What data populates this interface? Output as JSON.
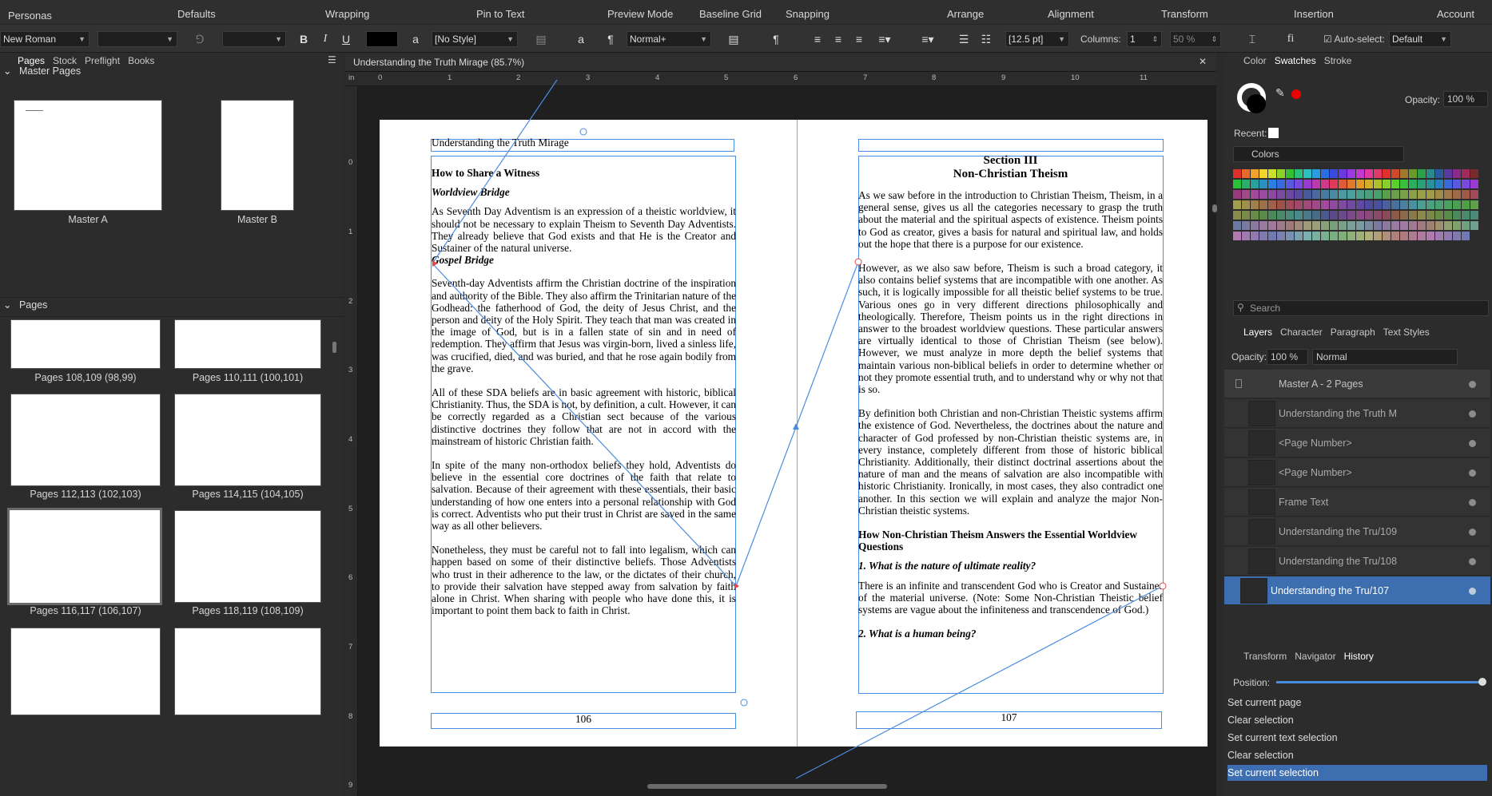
{
  "toolbar": {
    "personas": "Personas",
    "items": [
      "Defaults",
      "Wrapping",
      "Pin to Text",
      "Preview Mode",
      "Baseline Grid",
      "Snapping",
      "Arrange",
      "Alignment",
      "Transform",
      "Insertion",
      "Account"
    ]
  },
  "context": {
    "font": "New Roman",
    "style_none": "[No Style]",
    "para_style": "Normal+",
    "size": "[12.5 pt]",
    "columns_label": "Columns:",
    "columns": "1",
    "gutter": "50 %",
    "autoselect_label": "Auto-select:",
    "autoselect": "Default"
  },
  "left": {
    "tabs": [
      "Pages",
      "Stock",
      "Preflight",
      "Books"
    ],
    "master_title": "Master Pages",
    "masters": [
      "Master A",
      "Master B"
    ],
    "pages_title": "Pages",
    "page_captions": [
      "Pages 108,109 (98,99)",
      "Pages 110,111 (100,101)",
      "Pages 112,113 (102,103)",
      "Pages 114,115 (104,105)",
      "Pages 116,117 (106,107)",
      "Pages 118,119 (108,109)"
    ]
  },
  "doc": {
    "tab": "Understanding the Truth Mirage (85.7%)",
    "ruler_unit": "in",
    "ticks_h": [
      "0",
      "1",
      "2",
      "3",
      "4",
      "5",
      "6",
      "7",
      "8",
      "9",
      "10",
      "11"
    ],
    "ticks_v": [
      "0",
      "1",
      "2",
      "3",
      "4",
      "5",
      "6",
      "7",
      "8",
      "9"
    ]
  },
  "left_page": {
    "header": "Understanding the Truth Mirage",
    "h1": "How to Share a Witness",
    "h2": "Worldview Bridge",
    "p1": "As Seventh Day Adventism is an expression of a theistic worldview, it should not be necessary to explain Theism to Seventh Day Adventists. They already believe that God exists and that He is the Creator and Sustainer of the natural universe.",
    "h3": "Gospel Bridge",
    "p2": "Seventh-day Adventists affirm the Christian doctrine of the inspiration and authority of the Bible. They also affirm the Trinitarian nature of the Godhead: the fatherhood of God, the deity of Jesus Christ, and the person and deity of the Holy Spirit. They teach that man was created in the image of God, but is in a fallen state of sin and in need of redemption. They affirm that Jesus was virgin-born, lived a sinless life, was crucified, died, and was buried, and that he rose again bodily from the grave.",
    "p3": "All of these SDA beliefs are in basic agreement with historic, biblical Christianity. Thus, the SDA is not, by definition, a cult. However, it can be correctly regarded as a Christian sect because of the various distinctive doctrines they follow that are not in accord with the mainstream of historic Christian faith.",
    "p4": "In spite of the many non-orthodox beliefs they hold, Adventists do believe in the essential core doctrines of the faith that relate to salvation. Because of their agreement with these essentials, their basic understanding of how one enters into a personal relationship with God is correct. Adventists who put their trust in Christ are saved in the same way as all other believers.",
    "p5": "Nonetheless, they must be careful not to fall into legalism, which can happen based on some of their distinctive beliefs. Those Adventists who trust in their adherence to the law, or the dictates of their church, to provide their salvation have stepped away from salvation by faith alone in Christ. When sharing with people who have done this, it is important to point them back to faith in Christ.",
    "page_no": "106"
  },
  "right_page": {
    "title1": "Section III",
    "title2": "Non-Christian Theism",
    "p1": "As we saw before in the introduction to Christian Theism, Theism, in a general sense, gives us all the categories necessary to grasp the truth about the material and the spiritual aspects of existence. Theism points to God as creator, gives a basis for natural and spiritual law, and holds out the hope that there is a purpose for our existence.",
    "p2": "However, as we also saw before, Theism is such a broad category, it also contains belief systems that are incompatible with one another. As such, it is logically impossible for all theistic belief systems to be true. Various ones go in very different directions philosophically and theologically. Therefore, Theism points us in the right directions in answer to the broadest worldview questions. These particular answers are virtually identical to those of Christian Theism (see below). However, we must analyze in more depth the belief systems that maintain various non-biblical beliefs in order to determine whether or not they promote essential truth, and to understand why or why not that is so.",
    "p3": "By definition both Christian and non-Christian Theistic systems affirm the existence of God. Nevertheless, the doctrines about the nature and character of God professed by non-Christian theistic systems are, in every instance, completely different from those of historic biblical Christianity. Additionally, their distinct doctrinal assertions about the nature of man and the means of salvation are also incompatible with historic Christianity. Ironically, in most cases, they also contradict one another. In this section we will explain and analyze the major Non-Christian theistic systems.",
    "h1": "How Non-Christian Theism Answers the Essential Worldview Questions",
    "q1": "1. What is the nature of ultimate reality?",
    "p4": "There is an infinite and transcendent God who is Creator and Sustainer of the material universe. (Note: Some Non-Christian Theistic belief systems are vague about the infiniteness and transcendence of God.)",
    "q2": "2. What is a human being?",
    "page_no": "107"
  },
  "right": {
    "tabs1": [
      "Color",
      "Swatches",
      "Stroke"
    ],
    "opacity_label": "Opacity:",
    "opacity": "100 %",
    "recent": "Recent:",
    "palette": "Colors",
    "search": "Search",
    "tabs2": [
      "Layers",
      "Character",
      "Paragraph",
      "Text Styles"
    ],
    "layer_opacity": "100 %",
    "blend": "Normal",
    "layers": [
      "Master A - 2 Pages",
      "Understanding the Truth M",
      "<Page Number>",
      "<Page Number>",
      "Frame Text",
      "Understanding the Tru/109",
      "Understanding the Tru/108",
      "Understanding the Tru/107"
    ],
    "tabs3": [
      "Transform",
      "Navigator",
      "History"
    ],
    "position_label": "Position:",
    "history": [
      "Set current page",
      "Clear selection",
      "Set current text selection",
      "Clear selection",
      "Set current selection"
    ]
  },
  "colors": {
    "accent": "#4a8de0",
    "selected_row": "#3d6fb0"
  }
}
